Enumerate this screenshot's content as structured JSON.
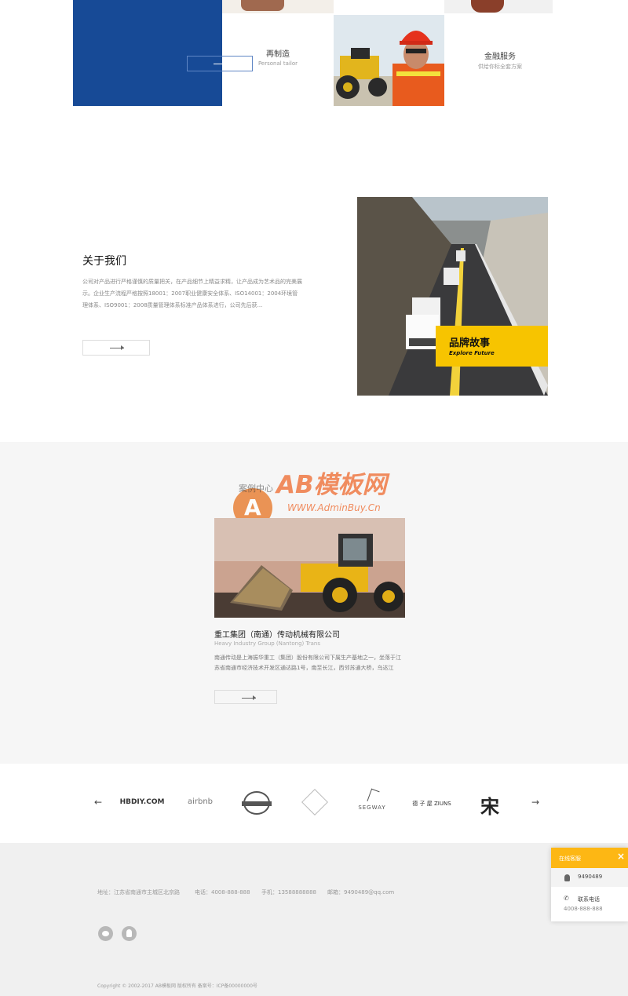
{
  "services": [
    {
      "title": "再制造",
      "subtitle": "Personal tailor"
    },
    {
      "title": "金融服务",
      "subtitle": "供给你标全套方案"
    }
  ],
  "about": {
    "title": "关于我们",
    "text": "公司对产品进行严格谨慎的质量把关，在产品细节上精益求精，让产品成为艺术品的完美展示。企业生产流程严格按照18001：2007职业健康安全体系、ISO14001：2004环境管理体系、ISO9001：2008质量管理体系标准产品体系进行，公司先后获...",
    "image_title": "品牌故事",
    "image_subtitle": "Explore Future"
  },
  "watermark": {
    "brand": "AB模板网",
    "url": "WWW.AdminBuy.Cn",
    "small": "案例中心"
  },
  "case": {
    "title": "重工集团（南通）传动机械有限公司",
    "subtitle": "Heavy Industry Group (Nantong) Trans",
    "text": "南通传动是上海振华重工（集团）股份有限公司下属生产基地之一，坐落于江苏省南通市经济技术开发区通达路1号，南至长江，西邻苏通大桥，乌达江"
  },
  "partners": {
    "prev": "←",
    "next": "→",
    "logos": [
      "HBDIY.COM",
      "airbnb",
      "cloverbanner",
      "crossmark",
      "SEGWAY",
      "德 子 屋 ZIUNS",
      "宋"
    ]
  },
  "footer": {
    "address": "地址：江苏省南通市主城区北京路",
    "phone": "电话：4008-888-888",
    "mobile": "手机：13588888888",
    "email": "邮箱：9490489@qq.com",
    "copyright": "Copyright © 2002-2017 AB模板网 版权所有 备案号：ICP备00000000号"
  },
  "widget": {
    "title": "在线客服",
    "close": "×",
    "qq": "9490489",
    "contact_label": "联系电话",
    "contact_phone": "4008-888-888"
  }
}
